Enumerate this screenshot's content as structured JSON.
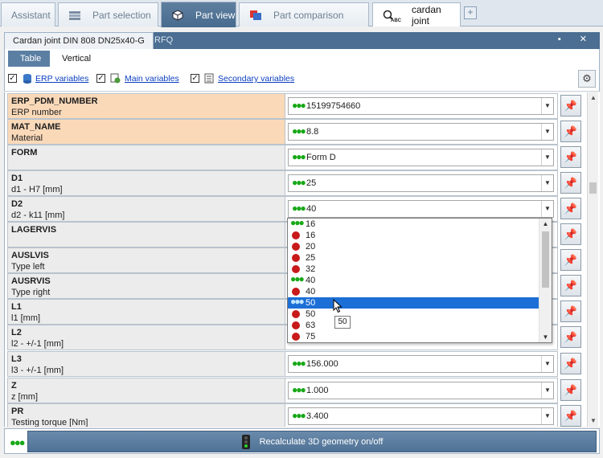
{
  "tabs": [
    {
      "label": "Assistant",
      "icon": "assistant-icon"
    },
    {
      "label": "Part selection",
      "icon": "part-selection-icon"
    },
    {
      "label": "Part view",
      "icon": "part-view-icon",
      "active": true
    },
    {
      "label": "Part comparison",
      "icon": "part-comparison-icon"
    },
    {
      "label": "cardan joint",
      "icon": "text-search-icon"
    }
  ],
  "add_tab_label": "+",
  "window": {
    "title": "Cardan joint DIN 808 DN25x40-G",
    "rfq": "RFQ",
    "controls": "▪ ✕"
  },
  "view_tabs": {
    "table": "Table",
    "vertical": "Vertical"
  },
  "filters": {
    "erp": "ERP variables",
    "main": "Main variables",
    "secondary": "Secondary variables",
    "check_mark": "✓"
  },
  "rows": [
    {
      "name": "ERP_PDM_NUMBER",
      "desc": "ERP number",
      "value": "15199754660",
      "highlight": true
    },
    {
      "name": "MAT_NAME",
      "desc": "Material",
      "value": "8.8",
      "highlight": true
    },
    {
      "name": "FORM",
      "desc": "",
      "value": "Form D",
      "highlight": false
    },
    {
      "name": "D1",
      "desc": "d1 - H7 [mm]",
      "value": "25",
      "highlight": false
    },
    {
      "name": "D2",
      "desc": "d2 - k11 [mm]",
      "value": "40",
      "highlight": false
    },
    {
      "name": "LAGERVIS",
      "desc": "",
      "value": "",
      "highlight": false
    },
    {
      "name": "AUSLVIS",
      "desc": "Type left",
      "value": "",
      "highlight": false
    },
    {
      "name": "AUSRVIS",
      "desc": "Type right",
      "value": "",
      "highlight": false
    },
    {
      "name": "L1",
      "desc": "l1 [mm]",
      "value": "",
      "highlight": false
    },
    {
      "name": "L2",
      "desc": "l2 - +/-1 [mm]",
      "value": "",
      "highlight": false
    },
    {
      "name": "L3",
      "desc": "l3 - +/-1 [mm]",
      "value": "156.000",
      "highlight": false
    },
    {
      "name": "Z",
      "desc": "z [mm]",
      "value": "1.000",
      "highlight": false
    },
    {
      "name": "PR",
      "desc": "Testing torque [Nm]",
      "value": "3.400",
      "highlight": false
    }
  ],
  "dropdown": {
    "items": [
      {
        "label": "16",
        "status": "green"
      },
      {
        "label": "16",
        "status": "red"
      },
      {
        "label": "20",
        "status": "red"
      },
      {
        "label": "25",
        "status": "red"
      },
      {
        "label": "32",
        "status": "red"
      },
      {
        "label": "40",
        "status": "green"
      },
      {
        "label": "40",
        "status": "red"
      },
      {
        "label": "50",
        "status": "green",
        "selected": true
      },
      {
        "label": "50",
        "status": "red"
      },
      {
        "label": "63",
        "status": "red"
      },
      {
        "label": "75",
        "status": "red"
      }
    ],
    "tooltip": "50"
  },
  "bottom": {
    "recalc_label": "Recalculate 3D geometry on/off",
    "status_dots": "●●●"
  },
  "colors": {
    "accent": "#4b6e92",
    "highlight_row": "#fad9b9",
    "selection": "#1c6fd6",
    "ok_green": "#18a818",
    "red_dot": "#c81a1a"
  },
  "glyphs": {
    "dots": "●●●",
    "arrow_down": "▼",
    "arrow_up": "▲",
    "pin": "📌",
    "gear": "⚙"
  }
}
